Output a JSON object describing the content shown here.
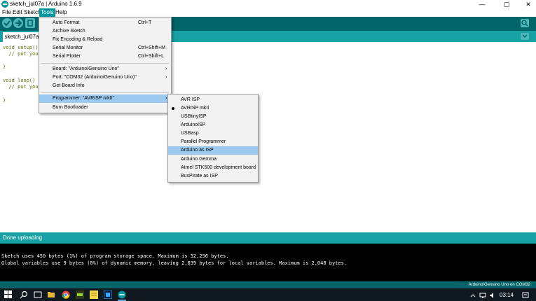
{
  "window": {
    "title": "sketch_jul07a | Arduino 1.6.9",
    "minimize": "—",
    "maximize": "▢",
    "close": "✕"
  },
  "menubar": [
    "File",
    "Edit",
    "Sketch",
    "Tools",
    "Help"
  ],
  "tab": {
    "label": "sketch_jul07a"
  },
  "code_lines": [
    "void setup() {",
    "  // put your",
    "",
    "}",
    "",
    "void loop() {",
    "  // put your",
    "",
    "}"
  ],
  "tools_menu": {
    "items": [
      {
        "label": "Auto Format",
        "shortcut": "Ctrl+T"
      },
      {
        "label": "Archive Sketch",
        "shortcut": ""
      },
      {
        "label": "Fix Encoding & Reload",
        "shortcut": ""
      },
      {
        "label": "Serial Monitor",
        "shortcut": "Ctrl+Shift+M"
      },
      {
        "label": "Serial Plotter",
        "shortcut": "Ctrl+Shift+L"
      },
      {
        "label": "Board: \"Arduino/Genuino Uno\"",
        "shortcut": ""
      },
      {
        "label": "Port: \"COM32 (Arduino/Genuino Uno)\"",
        "shortcut": ""
      },
      {
        "label": "Get Board Info",
        "shortcut": ""
      },
      {
        "label": "Programmer: \"AVRISP mkII\"",
        "shortcut": ""
      },
      {
        "label": "Burn Bootloader",
        "shortcut": ""
      }
    ]
  },
  "programmer_menu": {
    "items": [
      "AVR ISP",
      "AVRISP mkII",
      "USBtinyISP",
      "ArduinoISP",
      "USBasp",
      "Parallel Programmer",
      "Arduino as ISP",
      "Arduino Gemma",
      "Atmel STK500 development board",
      "BusPirate as ISP"
    ],
    "selected": "AVRISP mkII",
    "hovered": "Arduino as ISP"
  },
  "status": {
    "text": "Done uploading"
  },
  "console": {
    "lines": [
      "Sketch uses 450 bytes (1%) of program storage space. Maximum is 32,256 bytes.",
      "Global variables use 9 bytes (0%) of dynamic memory, leaving 2,039 bytes for local variables. Maximum is 2,048 bytes."
    ]
  },
  "footer": {
    "board_port": "Arduino/Genuino Uno on COM32"
  },
  "taskbar": {
    "clock": "03:14"
  },
  "colors": {
    "teal_dark": "#006468",
    "teal": "#17a1a5",
    "accent": "#00979d",
    "menu_highlight": "#9cc9f0"
  }
}
